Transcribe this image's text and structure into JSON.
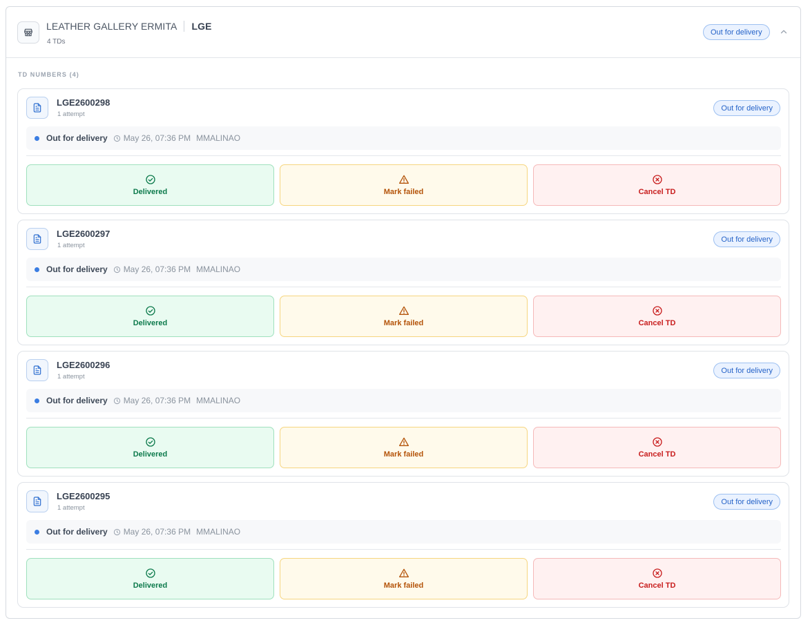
{
  "group": {
    "name": "LEATHER GALLERY ERMITA",
    "code": "LGE",
    "count_label": "4 TDs",
    "status": "Out for delivery",
    "store_icon": "store-icon",
    "collapse_icon": "chevron-up-icon"
  },
  "section": {
    "label": "TD NUMBERS (4)"
  },
  "tds": [
    {
      "number": "LGE2600298",
      "attempts": "1 attempt",
      "badge": "Out for delivery",
      "status": "Out for delivery",
      "time": "May 26, 07:36 PM",
      "user": "MMALINAO"
    },
    {
      "number": "LGE2600297",
      "attempts": "1 attempt",
      "badge": "Out for delivery",
      "status": "Out for delivery",
      "time": "May 26, 07:36 PM",
      "user": "MMALINAO"
    },
    {
      "number": "LGE2600296",
      "attempts": "1 attempt",
      "badge": "Out for delivery",
      "status": "Out for delivery",
      "time": "May 26, 07:36 PM",
      "user": "MMALINAO"
    },
    {
      "number": "LGE2600295",
      "attempts": "1 attempt",
      "badge": "Out for delivery",
      "status": "Out for delivery",
      "time": "May 26, 07:36 PM",
      "user": "MMALINAO"
    }
  ],
  "actions": {
    "delivered": "Delivered",
    "failed": "Mark failed",
    "cancel": "Cancel TD"
  },
  "colors": {
    "badge_blue": "#2563c8",
    "status_dot": "#3b7de2",
    "delivered_green": "#0d7a4c",
    "failed_amber": "#b45309",
    "cancel_red": "#c81e1e"
  }
}
